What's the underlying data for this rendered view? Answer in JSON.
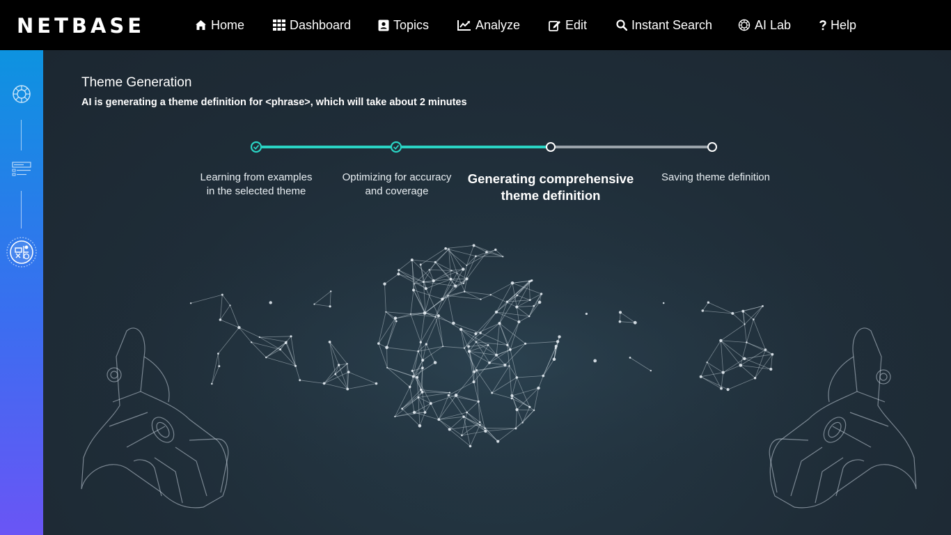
{
  "app": {
    "brand": "NETBASE"
  },
  "nav": {
    "items": [
      {
        "label": "Home",
        "icon": "home-icon"
      },
      {
        "label": "Dashboard",
        "icon": "grid-icon"
      },
      {
        "label": "Topics",
        "icon": "contact-card-icon"
      },
      {
        "label": "Analyze",
        "icon": "line-chart-icon"
      },
      {
        "label": "Edit",
        "icon": "edit-icon"
      },
      {
        "label": "Instant Search",
        "icon": "search-icon"
      },
      {
        "label": "AI Lab",
        "icon": "ai-lab-icon"
      },
      {
        "label": "Help",
        "icon": "help-icon"
      }
    ]
  },
  "sidebar": {
    "items": [
      {
        "icon": "ai-brain-icon"
      },
      {
        "icon": "theme-list-icon"
      },
      {
        "icon": "theme-generation-icon"
      }
    ]
  },
  "main": {
    "title": "Theme Generation",
    "subtitle": "AI is generating a theme definition for <phrase>, which will take about 2 minutes",
    "steps": [
      {
        "line1": "Learning from examples",
        "line2": "in the selected theme",
        "status": "complete"
      },
      {
        "line1": "Optimizing for accuracy",
        "line2": "and coverage",
        "status": "complete"
      },
      {
        "line1": "Generating comprehensive",
        "line2": "theme definition",
        "status": "active"
      },
      {
        "line1": "Saving theme definition",
        "line2": "",
        "status": "pending"
      }
    ]
  },
  "colors": {
    "accent": "#2ad4c4",
    "pending": "#9aa3aa",
    "topbar": "#000000",
    "background": "#1f2b36",
    "sidebar_top": "#0d93e0",
    "sidebar_bottom": "#6a55f5"
  }
}
